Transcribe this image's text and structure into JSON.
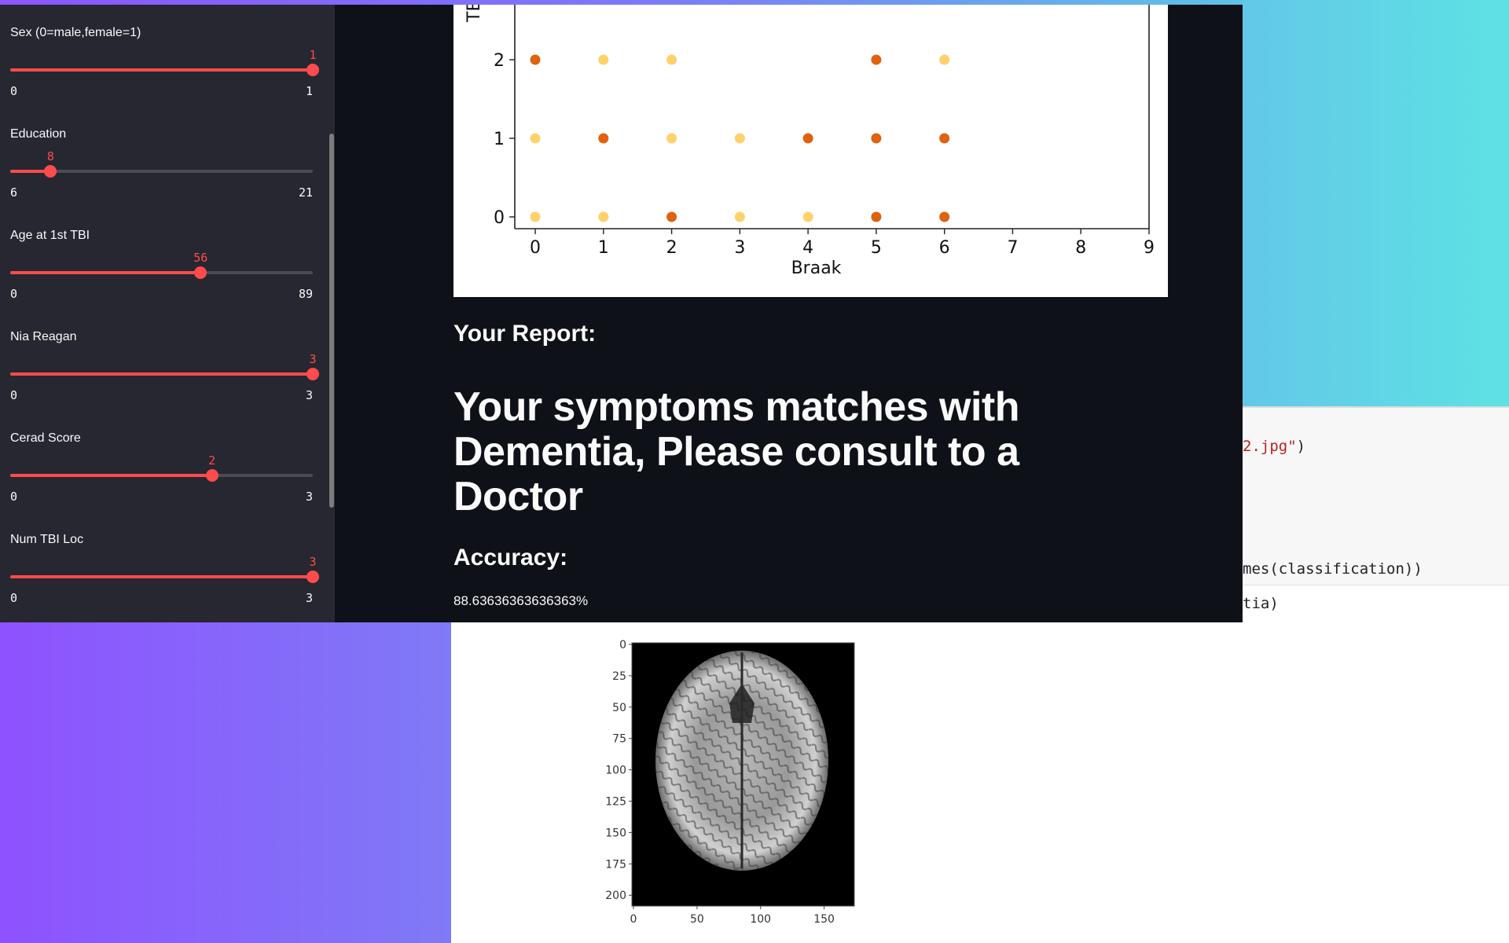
{
  "sidebar": {
    "sliders": [
      {
        "label": "Sex (0=male,female=1)",
        "value": 1,
        "min": 0,
        "max": 1,
        "value_text": "1",
        "min_text": "0",
        "max_text": "1"
      },
      {
        "label": "Education",
        "value": 8,
        "min": 6,
        "max": 21,
        "value_text": "8",
        "min_text": "6",
        "max_text": "21"
      },
      {
        "label": "Age at 1st TBI",
        "value": 56,
        "min": 0,
        "max": 89,
        "value_text": "56",
        "min_text": "0",
        "max_text": "89"
      },
      {
        "label": "Nia Reagan",
        "value": 3,
        "min": 0,
        "max": 3,
        "value_text": "3",
        "min_text": "0",
        "max_text": "3"
      },
      {
        "label": "Cerad Score",
        "value": 2,
        "min": 0,
        "max": 3,
        "value_text": "2",
        "min_text": "0",
        "max_text": "3"
      },
      {
        "label": "Num TBI Loc",
        "value": 3,
        "min": 0,
        "max": 3,
        "value_text": "3",
        "min_text": "0",
        "max_text": "3"
      }
    ]
  },
  "report": {
    "label": "Your Report:",
    "heading": "Your symptoms matches with Dementia, Please consult to a Doctor",
    "accuracy_label": "Accuracy:",
    "accuracy_value": "88.63636363636363%"
  },
  "chart_data": {
    "type": "scatter",
    "title": "",
    "xlabel": "Braak",
    "ylabel": "TB",
    "xlim": [
      -0.3,
      9
    ],
    "ylim": [
      -0.15,
      2.8
    ],
    "x_ticks": [
      "0",
      "1",
      "2",
      "3",
      "4",
      "5",
      "6",
      "7",
      "8",
      "9"
    ],
    "y_ticks": [
      "0",
      "1",
      "2"
    ],
    "colors": {
      "class_a": "#e0620f",
      "class_b": "#fed16b"
    },
    "points": [
      {
        "x": 0,
        "y": 2,
        "cls": "class_a"
      },
      {
        "x": 1,
        "y": 2,
        "cls": "class_b"
      },
      {
        "x": 2,
        "y": 2,
        "cls": "class_b"
      },
      {
        "x": 5,
        "y": 2,
        "cls": "class_a"
      },
      {
        "x": 6,
        "y": 2,
        "cls": "class_b"
      },
      {
        "x": 0,
        "y": 1,
        "cls": "class_b"
      },
      {
        "x": 1,
        "y": 1,
        "cls": "class_a"
      },
      {
        "x": 2,
        "y": 1,
        "cls": "class_b"
      },
      {
        "x": 3,
        "y": 1,
        "cls": "class_b"
      },
      {
        "x": 4,
        "y": 1,
        "cls": "class_a"
      },
      {
        "x": 5,
        "y": 1,
        "cls": "class_a"
      },
      {
        "x": 6,
        "y": 1,
        "cls": "class_a"
      },
      {
        "x": 0,
        "y": 0,
        "cls": "class_b"
      },
      {
        "x": 1,
        "y": 0,
        "cls": "class_b"
      },
      {
        "x": 2,
        "y": 0,
        "cls": "class_a"
      },
      {
        "x": 3,
        "y": 0,
        "cls": "class_b"
      },
      {
        "x": 4,
        "y": 0,
        "cls": "class_b"
      },
      {
        "x": 5,
        "y": 0,
        "cls": "class_a"
      },
      {
        "x": 6,
        "y": 0,
        "cls": "class_a"
      }
    ]
  },
  "notebook": {
    "code_line_1_str": "2.jpg\"",
    "code_line_1_tail": ")",
    "code_line_2": "mes(classification))",
    "output_line": "tia)",
    "image_plot": {
      "y_ticks": [
        "0",
        "25",
        "50",
        "75",
        "100",
        "125",
        "150",
        "175",
        "200"
      ],
      "x_ticks": [
        "0",
        "50",
        "100",
        "150"
      ]
    }
  },
  "theme": {
    "accent": "#ff4b4b",
    "sidebar_bg": "#262730",
    "main_bg": "#0e1117"
  }
}
